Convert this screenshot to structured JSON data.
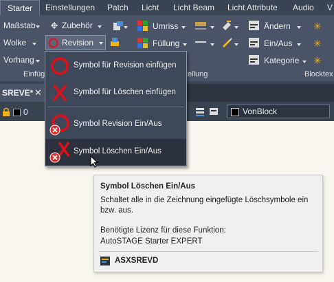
{
  "ribbon_tabs": [
    "Starter",
    "Einstellungen",
    "Patch",
    "Licht",
    "Licht Beam",
    "Licht Attribute",
    "Audio",
    "V"
  ],
  "einfuegen": {
    "massstab": "Maßstab",
    "wolke": "Wolke",
    "vorhang": "Vorhang",
    "zubehoer": "Zubehör",
    "revision": "Revision",
    "panel_title": "Einfüg"
  },
  "eigenschaften": {
    "umriss": "Umriss",
    "fuellung": "Füllung",
    "panel_title": "tellung"
  },
  "block": {
    "aendern": "Ändern",
    "ein_aus": "Ein/Aus",
    "kategorie": "Kategorie",
    "panel_title": "Blocktex"
  },
  "doc_tab": "SREVE*",
  "toolbar": {
    "layer_value": "0",
    "color_value": "VonBlock"
  },
  "revision_menu": [
    "Symbol für Revision einfügen",
    "Symbol für Löschen einfügen",
    "Symbol Revision Ein/Aus",
    "Symbol Löschen Ein/Aus"
  ],
  "tooltip": {
    "title": "Symbol Löschen Ein/Aus",
    "desc_line1": "Schaltet alle in die Zeichnung eingefügte Löschsymbole ein",
    "desc_line2": "bzw. aus.",
    "license_label": "Benötigte Lizenz für diese Funktion:",
    "license_value": "AutoSTAGE Starter EXPERT",
    "command": "ASXSREVD"
  },
  "colors": {
    "ribbon_bg": "#4a5466",
    "tab_bg": "#3b4453",
    "menu_bg": "#3f4858",
    "menu_hover": "#2b323e",
    "accent_red": "#e0101a"
  }
}
